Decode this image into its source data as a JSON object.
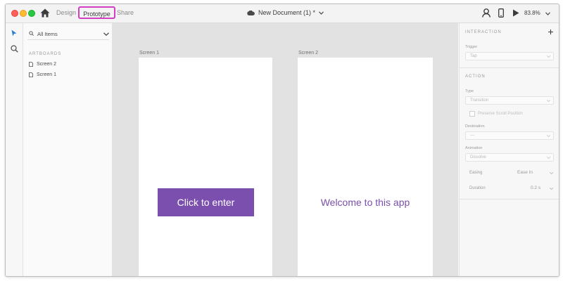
{
  "window": {
    "mode_tabs": {
      "design": "Design",
      "prototype": "Prototype",
      "share": "Share"
    },
    "document_title": "New Document (1) *",
    "zoom": "83.8%"
  },
  "icons": [
    "home-icon",
    "cloud-icon",
    "chevron-down-icon",
    "user-icon",
    "device-icon",
    "play-icon",
    "select-tool-icon",
    "zoom-tool-icon",
    "search-icon",
    "artboard-icon",
    "plus-icon"
  ],
  "layers": {
    "filter": "All Items",
    "section_title": "ARTBOARDS",
    "artboards": [
      "Screen 2",
      "Screen 1"
    ]
  },
  "canvas": {
    "artboards": [
      {
        "label": "Screen 1",
        "button": "Click to enter"
      },
      {
        "label": "Screen 2",
        "text": "Welcome to this app"
      }
    ],
    "accent_color": "#7b4fae",
    "background_color": "#e2e2e2"
  },
  "inspector": {
    "interaction_title": "INTERACTION",
    "trigger_label": "Trigger",
    "trigger_value": "Tap",
    "action_title": "ACTION",
    "type_label": "Type",
    "type_value": "Transition",
    "preserve_scroll": "Preserve Scroll Position",
    "destination_label": "Destination",
    "destination_value": "---",
    "animation_label": "Animation",
    "animation_value": "Dissolve",
    "easing_label": "Easing",
    "easing_value": "Ease In",
    "duration_label": "Duration",
    "duration_value": "0.2 s"
  },
  "colors": {
    "highlight": "#d23fc3",
    "close": "#ff5f57",
    "minimize": "#ffbd2e",
    "maximize": "#28c940"
  }
}
